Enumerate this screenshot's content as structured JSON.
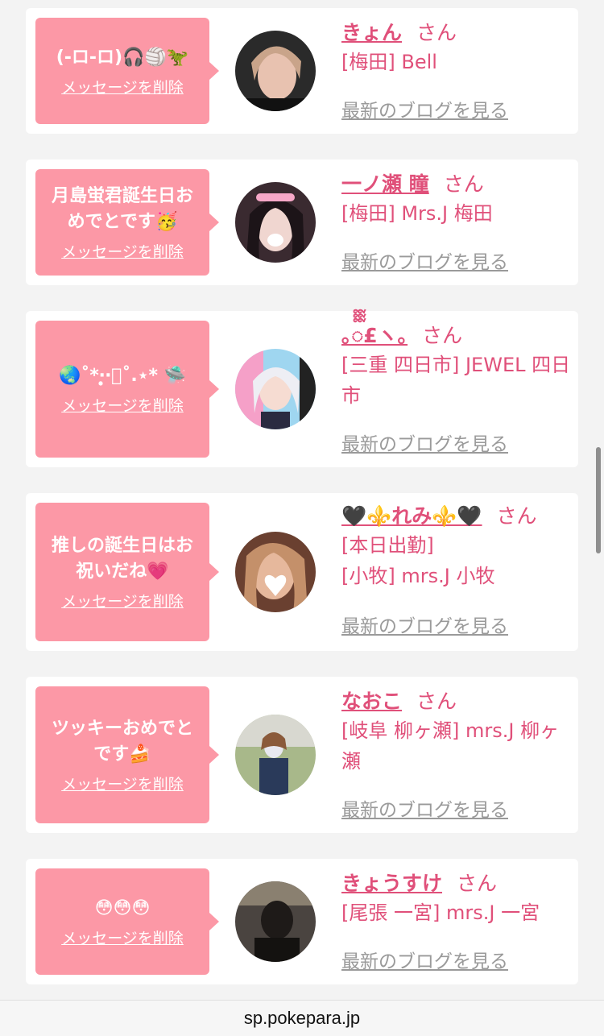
{
  "delete_label": "メッセージを削除",
  "blog_label": "最新のブログを見る",
  "san_label": "さん",
  "cards": [
    {
      "message": "(-ロ-ロ)🎧🏐🦖",
      "name": "きょん",
      "shop_lines": [
        "[梅田] Bell"
      ]
    },
    {
      "message": "月島蛍君誕生日おめでとです🥳",
      "name": "一ノ瀬 瞳",
      "shop_lines": [
        "[梅田] Mrs.J 梅田"
      ]
    },
    {
      "message": "🌏˚*‧̩̥̥‧͙˚.⋆* 🛸",
      "name": "｡ᢆ£ヽ｡",
      "shop_lines": [
        "[三重 四日市] JEWEL 四日市"
      ]
    },
    {
      "message": "推しの誕生日はお祝いだね💗",
      "name": "🖤⚜️れみ⚜️🖤",
      "shop_lines": [
        "[本日出勤]",
        "[小牧] mrs.J 小牧"
      ]
    },
    {
      "message": "ツッキーおめでとです🍰",
      "name": "なおこ",
      "shop_lines": [
        "[岐阜 柳ヶ瀬] mrs.J 柳ヶ瀬"
      ]
    },
    {
      "message": "😳😳😳",
      "name": "きょうすけ",
      "shop_lines": [
        "[尾張 一宮] mrs.J 一宮"
      ]
    }
  ],
  "url_bar": {
    "url": "sp.pokepara.jp"
  },
  "colors": {
    "accent": "#e0507a",
    "bubble": "#fc98a6",
    "muted": "#9a9a9a",
    "background": "#f3f3f3"
  }
}
